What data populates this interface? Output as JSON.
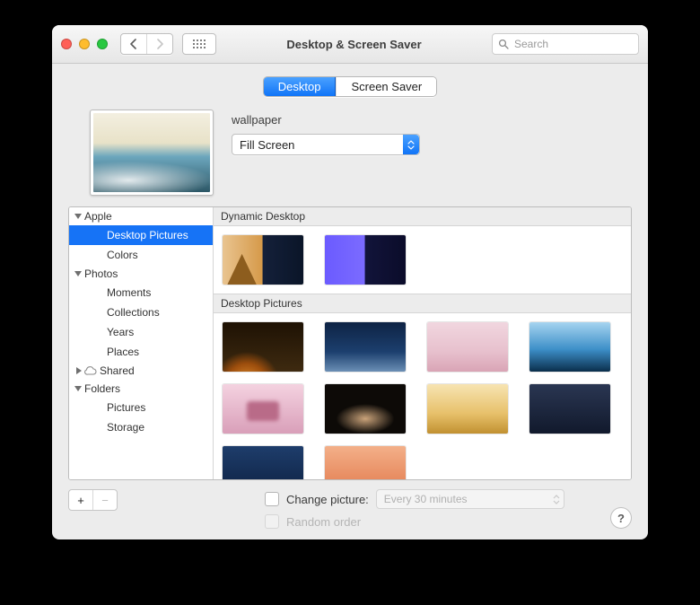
{
  "window": {
    "title": "Desktop & Screen Saver"
  },
  "toolbar": {
    "search_placeholder": "Search"
  },
  "tabs": {
    "desktop": "Desktop",
    "screensaver": "Screen Saver",
    "active": "desktop"
  },
  "preview": {
    "label": "wallpaper",
    "fill_mode": "Fill Screen"
  },
  "sidebar": {
    "groups": [
      {
        "name": "Apple",
        "expanded": true,
        "items": [
          {
            "label": "Desktop Pictures",
            "icon": "folder-blue",
            "selected": true
          },
          {
            "label": "Colors",
            "icon": "colorwheel"
          }
        ]
      },
      {
        "name": "Photos",
        "expanded": true,
        "items": [
          {
            "label": "Moments",
            "icon": "folder-gray"
          },
          {
            "label": "Collections",
            "icon": "folder-gray"
          },
          {
            "label": "Years",
            "icon": "folder-gray"
          },
          {
            "label": "Places",
            "icon": "folder-gray"
          }
        ]
      },
      {
        "name": "Shared",
        "expanded": false,
        "icon": "cloud",
        "items": []
      },
      {
        "name": "Folders",
        "expanded": true,
        "items": [
          {
            "label": "Pictures",
            "icon": "folder-blue"
          },
          {
            "label": "Storage",
            "icon": "folder-blue"
          }
        ]
      }
    ]
  },
  "content": {
    "sections": [
      {
        "title": "Dynamic Desktop",
        "thumbs": [
          "dyn1",
          "dyn2"
        ]
      },
      {
        "title": "Desktop Pictures",
        "thumbs": [
          "a",
          "b",
          "c",
          "d",
          "e",
          "f",
          "g",
          "h",
          "i",
          "j"
        ]
      }
    ]
  },
  "bottom": {
    "add_label": "+",
    "remove_label": "−",
    "change_picture_label": "Change picture:",
    "change_picture_checked": false,
    "interval": "Every 30 minutes",
    "random_label": "Random order",
    "random_enabled": false,
    "help_label": "?"
  }
}
